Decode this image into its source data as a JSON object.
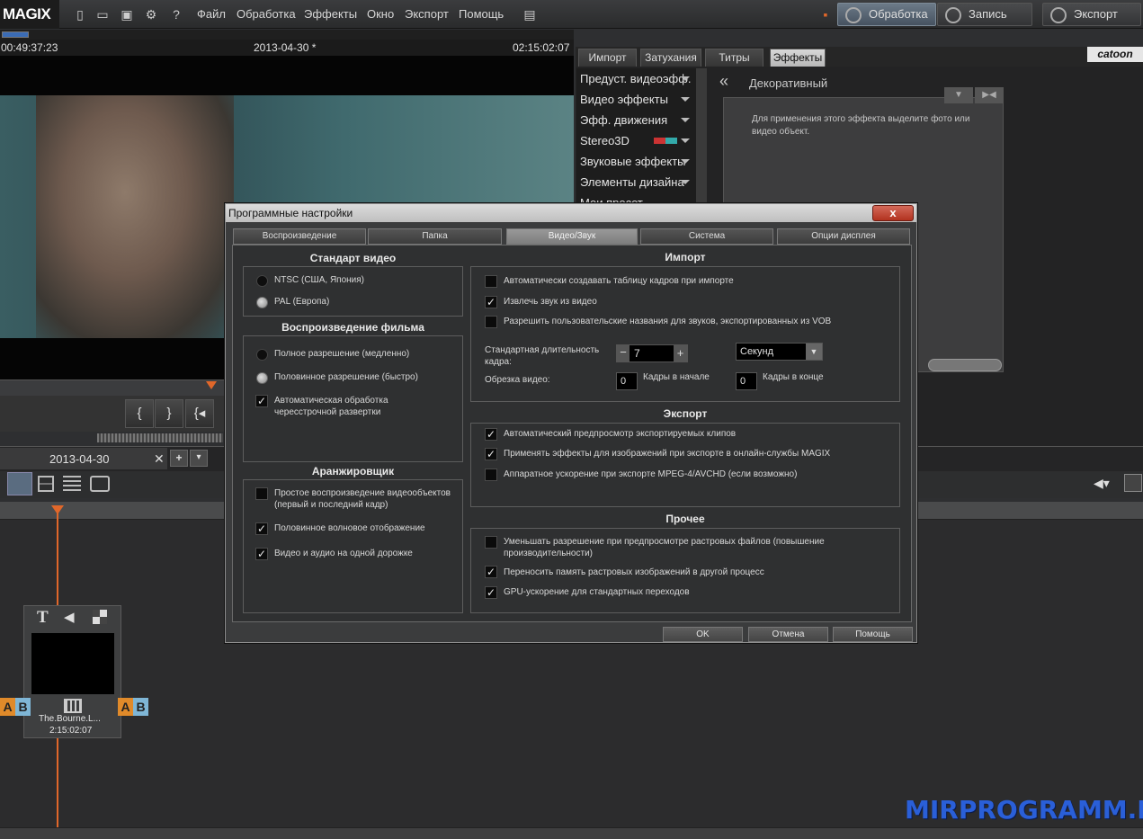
{
  "app": {
    "logo": "MAGIX"
  },
  "menu": [
    "Файл",
    "Обработка",
    "Эффекты",
    "Окно",
    "Экспорт",
    "Помощь"
  ],
  "top_buttons": {
    "edit": "Обработка",
    "record": "Запись",
    "export": "Экспорт"
  },
  "preview": {
    "tc_left": "00:49:37:23",
    "tc_center": "2013-04-30 *",
    "tc_right": "02:15:02:07"
  },
  "transport": [
    "{",
    "}",
    "{◂"
  ],
  "right_tabs": [
    "Импорт",
    "Затухания",
    "Титры",
    "Эффекты"
  ],
  "brand_badge": "catoon",
  "effects_menu": [
    "Предуст. видеоэфф.",
    "Видео эффекты",
    "Эфф. движения",
    "Stereo3D",
    "Звуковые эффекты",
    "Элементы дизайна",
    "Мои пресет"
  ],
  "decor": {
    "title": "Декоративный",
    "hint": "Для применения этого эффекта выделите фото или видео объект."
  },
  "timeline": {
    "tab": "2013-04-30",
    "clip_name": "The.Bourne.L...",
    "clip_duration": "2:15:02:07",
    "a": "A",
    "b": "B",
    "title_tool": "T"
  },
  "watermark": "MIRPROGRAMM.RU",
  "dialog": {
    "title": "Программные настройки",
    "close": "x",
    "tabs": [
      "Воспроизведение",
      "Папка",
      "Видео/Звук",
      "Система",
      "Опции дисплея"
    ],
    "video_standard": {
      "title": "Стандарт видео",
      "options": [
        "NTSC (США, Япония)",
        "PAL (Европа)"
      ]
    },
    "playback": {
      "title": "Воспроизведение фильма",
      "options": [
        "Полное разрешение (медленно)",
        "Половинное разрешение (быстро)"
      ],
      "checkbox": "Автоматическая обработка чересстрочной развертки"
    },
    "arranger": {
      "title": "Аранжировщик",
      "options": [
        "Простое воспроизведение видеообъектов (первый и последний кадр)",
        "Половинное волновое отображение",
        "Видео и аудио на одной дорожке"
      ]
    },
    "import": {
      "title": "Импорт",
      "options": [
        "Автоматически создавать таблицу кадров при импорте",
        "Извлечь звук из видео",
        "Разрешить пользовательские названия для звуков, экспортированных из VOB"
      ],
      "duration_label": "Стандартная длительность кадра:",
      "duration_value": "7",
      "unit": "Секунд",
      "trim_label": "Обрезка видео:",
      "trim_start": "0",
      "trim_start_label": "Кадры в начале",
      "trim_end": "0",
      "trim_end_label": "Кадры в конце"
    },
    "export": {
      "title": "Экспорт",
      "options": [
        "Автоматический предпросмотр экспортируемых клипов",
        "Применять эффекты для изображений при экспорте в онлайн-службы MAGIX",
        "Аппаратное ускорение при экспорте MPEG-4/AVCHD (если возможно)"
      ]
    },
    "other": {
      "title": "Прочее",
      "options": [
        "Уменьшать разрешение при предпросмотре растровых файлов (повышение производительности)",
        "Переносить память растровых изображений в другой процесс",
        "GPU-ускорение для стандартных переходов"
      ]
    },
    "buttons": {
      "ok": "OK",
      "cancel": "Отмена",
      "help": "Помощь"
    }
  }
}
